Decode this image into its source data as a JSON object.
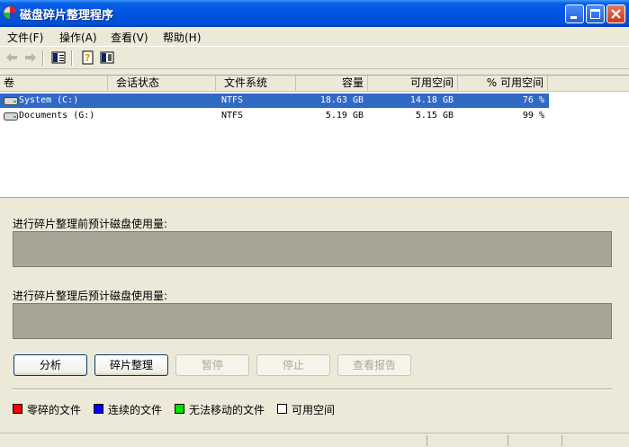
{
  "window": {
    "title": "磁盘碎片整理程序"
  },
  "menu": {
    "items": [
      "文件(F)",
      "操作(A)",
      "查看(V)",
      "帮助(H)"
    ]
  },
  "toolbar": {
    "icons": [
      "back-arrow-icon",
      "forward-arrow-icon",
      "properties-icon",
      "help-icon",
      "show-hide-icon"
    ]
  },
  "list": {
    "headers": [
      "卷",
      "会话状态",
      "文件系统",
      "容量",
      "可用空间",
      "% 可用空间"
    ],
    "rows": [
      {
        "volume": "System (C:)",
        "status": "",
        "fs": "NTFS",
        "capacity": "18.63 GB",
        "free": "14.18 GB",
        "pct": "76 %"
      },
      {
        "volume": "Documents (G:)",
        "status": "",
        "fs": "NTFS",
        "capacity": "5.19 GB",
        "free": "5.15 GB",
        "pct": "99 %"
      }
    ]
  },
  "panel": {
    "before_label": "进行碎片整理前预计磁盘使用量:",
    "after_label": "进行碎片整理后预计磁盘使用量:"
  },
  "buttons": {
    "analyze": "分析",
    "defragment": "碎片整理",
    "pause": "暂停",
    "stop": "停止",
    "view_report": "查看报告"
  },
  "legend": {
    "items": [
      {
        "label": "零碎的文件",
        "color": "#ff0000"
      },
      {
        "label": "连续的文件",
        "color": "#0000ff"
      },
      {
        "label": "无法移动的文件",
        "color": "#00e000"
      },
      {
        "label": "可用空间",
        "color": "#ffffff"
      }
    ]
  }
}
